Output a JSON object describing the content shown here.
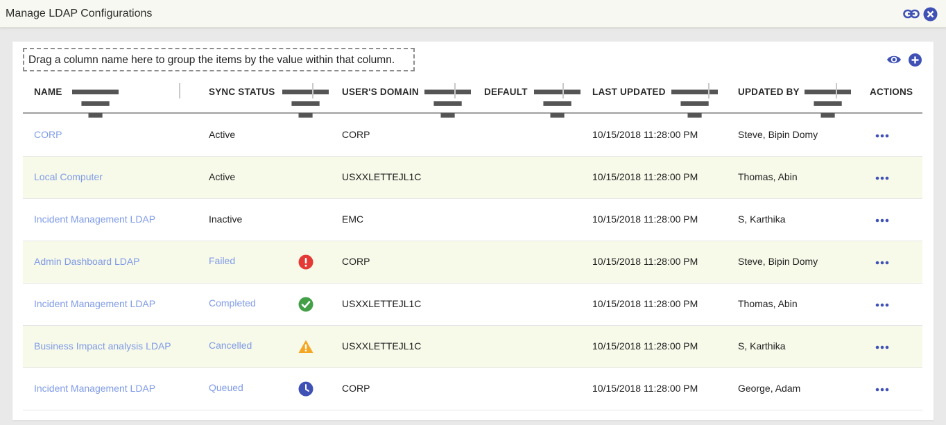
{
  "window": {
    "title": "Manage LDAP Configurations"
  },
  "toolbar": {
    "group_hint": "Drag a column name here to group the items by the value within that column.",
    "icons": [
      "link-icon",
      "close-icon",
      "eye-icon",
      "add-icon"
    ]
  },
  "colors": {
    "link": "#7f9be6",
    "alt_row": "#f7f9e9",
    "accent": "#3f51b5",
    "failed": "#e53935",
    "completed": "#43a047",
    "cancelled": "#f5a623",
    "queued": "#3f51b5"
  },
  "table": {
    "columns": [
      "NAME",
      "SYNC STATUS",
      "USER'S DOMAIN",
      "DEFAULT",
      "LAST UPDATED",
      "UPDATED BY",
      "ACTIONS"
    ],
    "rows": [
      {
        "name": "CORP",
        "status": "Active",
        "status_icon": "",
        "domain": "CORP",
        "default": "",
        "last_updated": "10/15/2018 11:28:00 PM",
        "updated_by": "Steve, Bipin Domy"
      },
      {
        "name": "Local Computer",
        "status": "Active",
        "status_icon": "",
        "domain": "USXXLETTEJL1C",
        "default": "",
        "last_updated": "10/15/2018 11:28:00 PM",
        "updated_by": "Thomas, Abin"
      },
      {
        "name": "Incident Management LDAP",
        "status": "Inactive",
        "status_icon": "",
        "domain": "EMC",
        "default": "",
        "last_updated": "10/15/2018 11:28:00 PM",
        "updated_by": "S, Karthika"
      },
      {
        "name": "Admin Dashboard LDAP",
        "status": "Failed",
        "status_icon": "error-icon",
        "domain": "CORP",
        "default": "",
        "last_updated": "10/15/2018 11:28:00 PM",
        "updated_by": "Steve, Bipin Domy"
      },
      {
        "name": "Incident Management LDAP",
        "status": "Completed",
        "status_icon": "check-circle-icon",
        "domain": "USXXLETTEJL1C",
        "default": "",
        "last_updated": "10/15/2018 11:28:00 PM",
        "updated_by": "Thomas, Abin"
      },
      {
        "name": "Business Impact analysis LDAP",
        "status": "Cancelled",
        "status_icon": "warning-icon",
        "domain": "USXXLETTEJL1C",
        "default": "",
        "last_updated": "10/15/2018 11:28:00 PM",
        "updated_by": "S, Karthika"
      },
      {
        "name": "Incident Management LDAP",
        "status": "Queued",
        "status_icon": "clock-icon",
        "domain": "CORP",
        "default": "",
        "last_updated": "10/15/2018 11:28:00 PM",
        "updated_by": "George, Adam"
      }
    ]
  }
}
